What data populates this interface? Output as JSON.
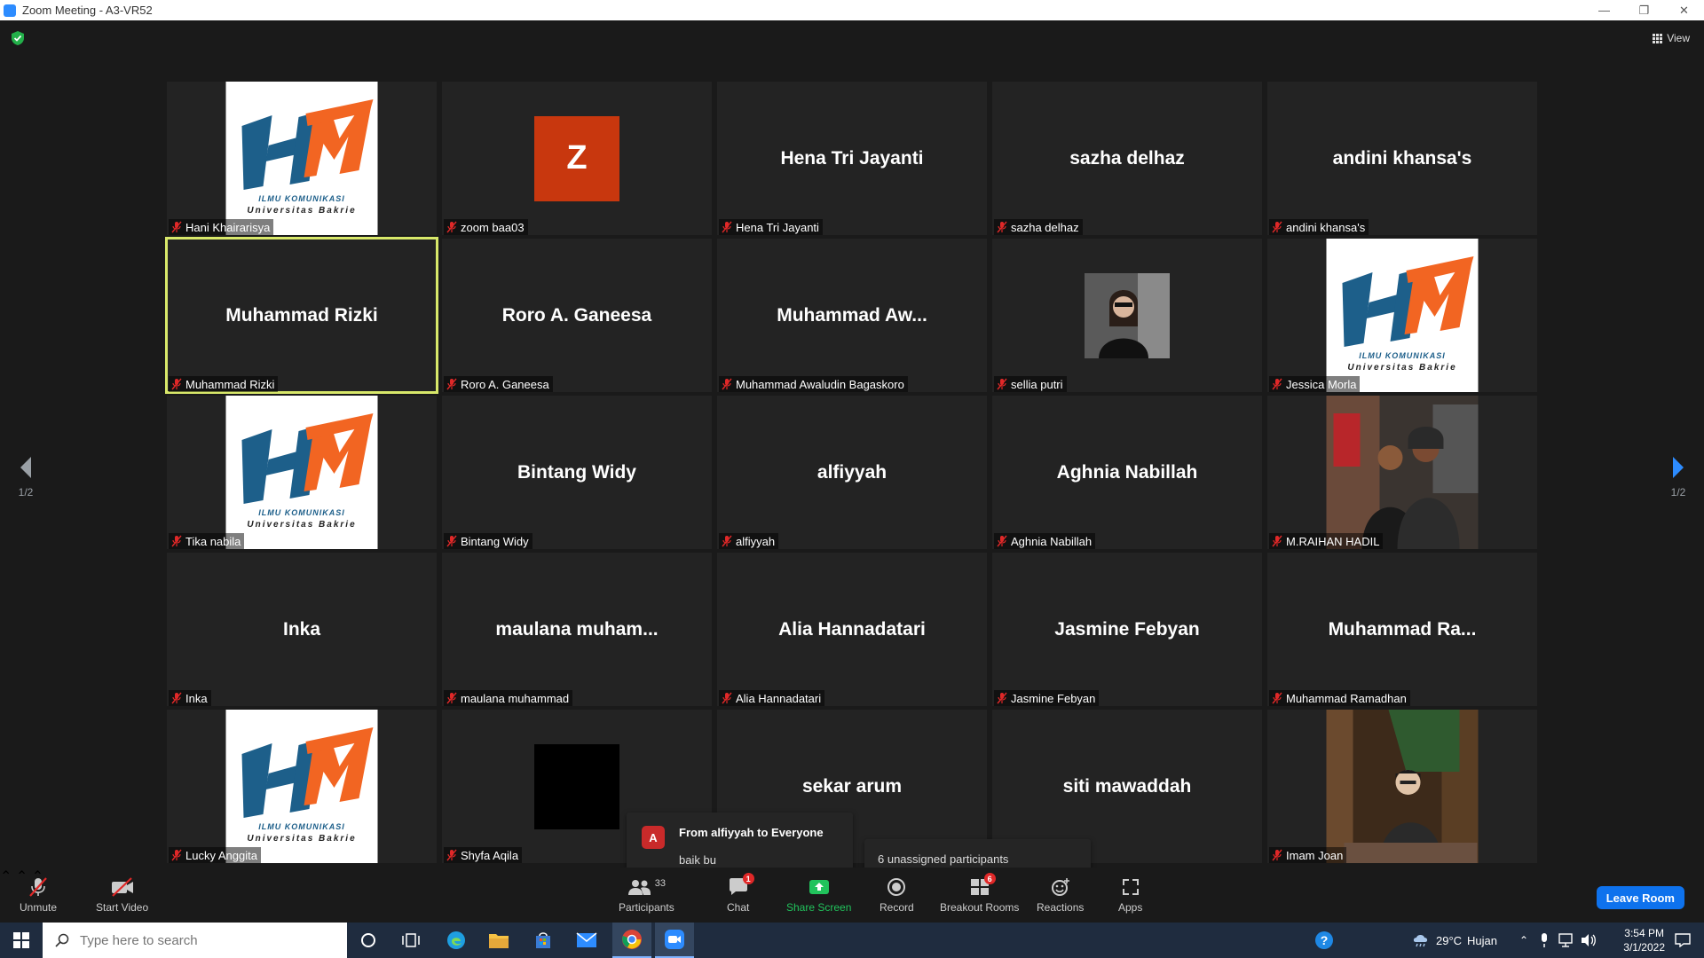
{
  "window": {
    "title": "Zoom Meeting - A3-VR52"
  },
  "top": {
    "view_label": "View"
  },
  "pager": {
    "left_label": "1/2",
    "right_label": "1/2"
  },
  "tiles": [
    {
      "label": "Hani Khairarisya",
      "big": "",
      "kind": "hm-logo",
      "active": false
    },
    {
      "label": "zoom baa03",
      "big": "Z",
      "kind": "avatar",
      "active": false
    },
    {
      "label": "Hena Tri Jayanti",
      "big": "Hena Tri Jayanti",
      "kind": "name",
      "active": false
    },
    {
      "label": "sazha delhaz",
      "big": "sazha delhaz",
      "kind": "name",
      "active": false
    },
    {
      "label": "andini khansa's",
      "big": "andini khansa's",
      "kind": "name",
      "active": false
    },
    {
      "label": "Muhammad Rizki",
      "big": "Muhammad Rizki",
      "kind": "name",
      "active": true
    },
    {
      "label": "Roro A. Ganeesa",
      "big": "Roro A. Ganeesa",
      "kind": "name",
      "active": false
    },
    {
      "label": "Muhammad Awaludin Bagaskoro",
      "big": "Muhammad  Aw...",
      "kind": "name",
      "active": false
    },
    {
      "label": "sellia putri",
      "big": "",
      "kind": "photo-small",
      "active": false
    },
    {
      "label": "Jessica Morla",
      "big": "",
      "kind": "hm-logo",
      "active": false
    },
    {
      "label": "Tika nabila",
      "big": "",
      "kind": "hm-logo",
      "active": false
    },
    {
      "label": "Bintang Widy",
      "big": "Bintang Widy",
      "kind": "name",
      "active": false
    },
    {
      "label": "alfiyyah",
      "big": "alfiyyah",
      "kind": "name",
      "active": false
    },
    {
      "label": "Aghnia Nabillah",
      "big": "Aghnia Nabillah",
      "kind": "name",
      "active": false
    },
    {
      "label": "M.RAIHAN HADIL",
      "big": "",
      "kind": "photo-two",
      "active": false
    },
    {
      "label": "Inka",
      "big": "Inka",
      "kind": "name",
      "active": false
    },
    {
      "label": "maulana muhammad",
      "big": "maulana  muham...",
      "kind": "name",
      "active": false
    },
    {
      "label": "Alia Hannadatari",
      "big": "Alia Hannadatari",
      "kind": "name",
      "active": false
    },
    {
      "label": "Jasmine Febyan",
      "big": "Jasmine Febyan",
      "kind": "name",
      "active": false
    },
    {
      "label": "Muhammad Ramadhan",
      "big": "Muhammad  Ra...",
      "kind": "name",
      "active": false
    },
    {
      "label": "Lucky Anggita",
      "big": "",
      "kind": "hm-logo",
      "active": false
    },
    {
      "label": "Shyfa Aqila",
      "big": "",
      "kind": "black",
      "active": false
    },
    {
      "label": "",
      "big": "sekar arum",
      "kind": "name",
      "active": false
    },
    {
      "label": "",
      "big": "siti mawaddah",
      "kind": "name",
      "active": false
    },
    {
      "label": "Imam Joan",
      "big": "",
      "kind": "photo-man",
      "active": false
    }
  ],
  "logo": {
    "line1": "ILMU KOMUNIKASI",
    "line2": "Universitas Bakrie"
  },
  "chat_popup": {
    "avatar": "A",
    "from": "From alfiyyah to Everyone",
    "message": "baik bu"
  },
  "unassigned_popup": {
    "text": "6 unassigned participants"
  },
  "toolbar": {
    "unmute": "Unmute",
    "start_video": "Start Video",
    "participants": "Participants",
    "participants_count": "33",
    "chat": "Chat",
    "chat_badge": "1",
    "share_screen": "Share Screen",
    "record": "Record",
    "breakout_rooms": "Breakout Rooms",
    "breakout_badge": "6",
    "reactions": "Reactions",
    "apps": "Apps",
    "leave_room": "Leave Room"
  },
  "taskbar": {
    "search_placeholder": "Type here to search",
    "weather_temp": "29°C",
    "weather_text": "Hujan",
    "time": "3:54 PM",
    "date": "3/1/2022"
  },
  "colors": {
    "accent": "#0e72ed",
    "active_border": "#d8e86a",
    "share_green": "#21c35c",
    "avatar_orange": "#c8370e"
  }
}
